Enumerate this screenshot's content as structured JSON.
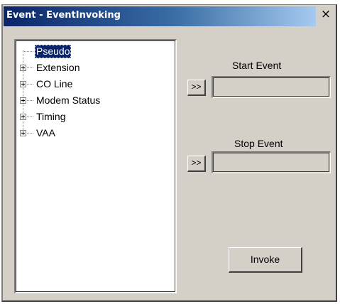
{
  "window": {
    "title": "Event - EventInvoking",
    "close_glyph": "×"
  },
  "tree": {
    "items": [
      {
        "label": "Pseudo",
        "expandable": false,
        "selected": true
      },
      {
        "label": "Extension",
        "expandable": true,
        "selected": false
      },
      {
        "label": "CO Line",
        "expandable": true,
        "selected": false
      },
      {
        "label": "Modem Status",
        "expandable": true,
        "selected": false
      },
      {
        "label": "Timing",
        "expandable": true,
        "selected": false
      },
      {
        "label": "VAA",
        "expandable": true,
        "selected": false
      }
    ]
  },
  "start_event": {
    "label": "Start Event",
    "button_label": ">>",
    "value": ""
  },
  "stop_event": {
    "label": "Stop Event",
    "button_label": ">>",
    "value": ""
  },
  "invoke": {
    "label": "Invoke"
  },
  "colors": {
    "title_start": "#0a246a",
    "title_end": "#a6caf0",
    "window_bg": "#d4d0c8",
    "selection": "#0a246a"
  }
}
